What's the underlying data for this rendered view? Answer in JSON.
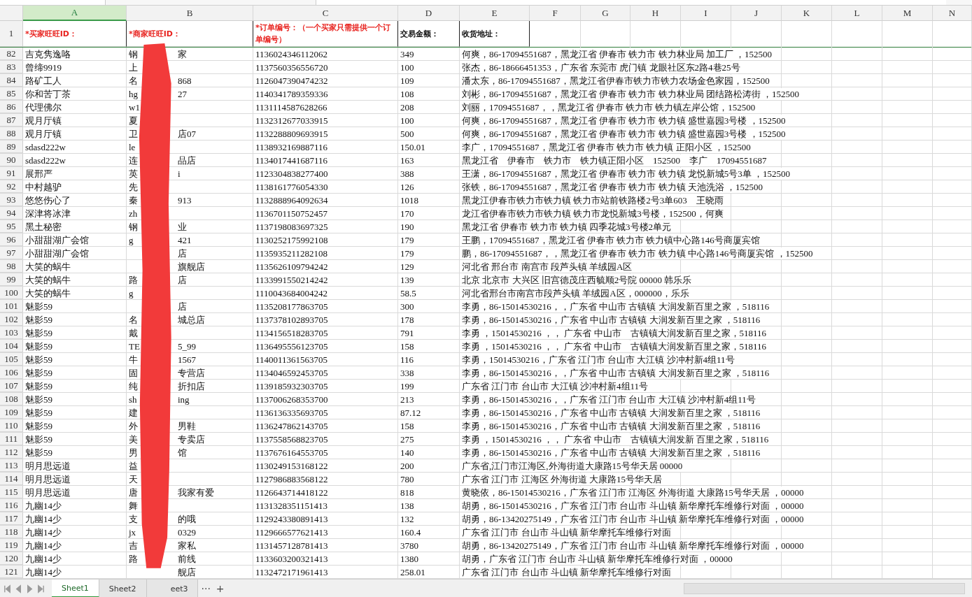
{
  "spreadsheet": {
    "column_headers": [
      {
        "label": "A",
        "selected": true
      },
      {
        "label": "B",
        "selected": false
      },
      {
        "label": "C",
        "selected": false
      },
      {
        "label": "D",
        "selected": false
      },
      {
        "label": "E",
        "selected": false
      },
      {
        "label": "F",
        "selected": false
      },
      {
        "label": "G",
        "selected": false
      },
      {
        "label": "H",
        "selected": false
      },
      {
        "label": "I",
        "selected": false
      },
      {
        "label": "J",
        "selected": false
      },
      {
        "label": "K",
        "selected": false
      },
      {
        "label": "L",
        "selected": false
      },
      {
        "label": "M",
        "selected": false
      },
      {
        "label": "N",
        "selected": false
      }
    ],
    "header_row": {
      "row_number": "1",
      "cells": [
        {
          "text": "*买家旺旺ID：",
          "required": true
        },
        {
          "text": "*商家旺旺ID：",
          "required": true
        },
        {
          "text": "*订单编号：（一个买家只需提供一个订单编号）",
          "required": true
        },
        {
          "text": "交易金额：",
          "required": false
        },
        {
          "text": "收货地址：",
          "required": false
        }
      ]
    },
    "rows": [
      {
        "row_number": "82",
        "buyer_id": "吉克隽逸咯",
        "shop_start": "钢",
        "shop_end": "家",
        "order_no": "1136024346112062",
        "amount": "349",
        "address": "何爽，86-17094551687，黑龙江省 伊春市 铁力市 铁力林业局 加工厂 ，152500"
      },
      {
        "row_number": "83",
        "buyer_id": "曾缔9919",
        "shop_start": "上",
        "order_no": "1137560356556720",
        "amount": "100",
        "address": "张杰，86-18666451353，广东省 东莞市 虎门镇 龙眼社区东2路4巷25号"
      },
      {
        "row_number": "84",
        "buyer_id": "路矿工人",
        "shop_start": "名",
        "shop_end": "868",
        "order_no": "1126047390474232",
        "amount": "109",
        "address": "潘太东，86-17094551687，黑龙江省伊春市铁力市铁力农场金色家园，152500"
      },
      {
        "row_number": "85",
        "buyer_id": "你和苦丁茶",
        "shop_start": "hg",
        "shop_end": "27",
        "order_no": "1140341789359336",
        "amount": "108",
        "address": "刘彬，86-17094551687，黑龙江省 伊春市 铁力市 铁力林业局 团结路松涛街 ，152500"
      },
      {
        "row_number": "86",
        "buyer_id": "代理佛尔",
        "shop_start": "w1",
        "order_no": "1131114587628266",
        "amount": "208",
        "address": "刘丽，17094551687，，黑龙江省 伊春市 铁力市 铁力镇左岸公馆，152500"
      },
      {
        "row_number": "87",
        "buyer_id": "观月厅镇",
        "shop_start": "夏",
        "order_no": "1132312677033915",
        "amount": "100",
        "address": "何爽，86-17094551687，黑龙江省 伊春市 铁力市 铁力镇 盛世嘉园3号楼 ，152500"
      },
      {
        "row_number": "88",
        "buyer_id": "观月厅镇",
        "shop_start": "卫",
        "shop_end": "店07",
        "order_no": "1132288809693915",
        "amount": "500",
        "address": "何爽，86-17094551687，黑龙江省 伊春市 铁力市 铁力镇 盛世嘉园3号楼 ，152500"
      },
      {
        "row_number": "89",
        "buyer_id": "sdasd222w",
        "shop_start": "le",
        "order_no": "1138932169887116",
        "amount": "150.01",
        "address": "李广，17094551687，黑龙江省 伊春市 铁力市 铁力镇 正阳小区 ，152500"
      },
      {
        "row_number": "90",
        "buyer_id": "sdasd222w",
        "shop_start": "连",
        "shop_end": "品店",
        "order_no": "1134017441687116",
        "amount": "163",
        "address": "黑龙江省　伊春市　铁力市　铁力镇正阳小区　152500　李广　17094551687"
      },
      {
        "row_number": "91",
        "buyer_id": "展邢严",
        "shop_start": "英",
        "shop_end": "i",
        "order_no": "1123304838277400",
        "amount": "388",
        "address": "王潇，86-17094551687，黑龙江省 伊春市 铁力市 铁力镇 龙悦新城5号3单 ，152500"
      },
      {
        "row_number": "92",
        "buyer_id": "中村越驴",
        "shop_start": "先",
        "order_no": "1138161776054330",
        "amount": "126",
        "address": "张铁，86-17094551687，黑龙江省 伊春市 铁力市 铁力镇 天池洗浴 ，152500"
      },
      {
        "row_number": "93",
        "buyer_id": "悠悠伤心了",
        "shop_start": "秦",
        "shop_end": "913",
        "order_no": "1132888964092634",
        "amount": "1018",
        "address": "黑龙江伊春市铁力市铁力镇 铁力市站前铁路楼2号3单603　王晓雨"
      },
      {
        "row_number": "94",
        "buyer_id": "深津将冰津",
        "shop_start": "zh",
        "order_no": "1136701150752457",
        "amount": "170",
        "address": "龙江省伊春市铁力市铁力镇 铁力市龙悦新城3号楼，152500，何爽"
      },
      {
        "row_number": "95",
        "buyer_id": "黑土秘密",
        "shop_start": "钢",
        "shop_end": "业",
        "order_no": "1137198083697325",
        "amount": "190",
        "address": "黑龙江省 伊春市 铁力市 铁力镇 四季花城3号楼2单元"
      },
      {
        "row_number": "96",
        "buyer_id": "小甜甜湖广会馆",
        "shop_start": "g",
        "shop_end": "421",
        "order_no": "1130252175992108",
        "amount": "179",
        "address": "王鹏，17094551687，黑龙江省 伊春市 铁力市 铁力镇中心路146号商厦宾馆"
      },
      {
        "row_number": "97",
        "buyer_id": "小甜甜湖广会馆",
        "shop_end": "店",
        "order_no": "1135935211282108",
        "amount": "179",
        "address": "鹏，86-17094551687，，黑龙江省 伊春市 铁力市 铁力镇 中心路146号商厦宾馆 ，152500"
      },
      {
        "row_number": "98",
        "buyer_id": "大笑的蜗牛",
        "shop_end": "旗舰店",
        "order_no": "1135626109794242",
        "amount": "129",
        "address": "河北省 邢台市 南宫市 段芦头镇 羊绒园A区"
      },
      {
        "row_number": "99",
        "buyer_id": "大笑的蜗牛",
        "shop_start": "路",
        "shop_end": "店",
        "order_no": "1133991550214242",
        "amount": "139",
        "address": "北京 北京市 大兴区 旧宫德茂庄西毓顺2号院 00000 韩乐乐"
      },
      {
        "row_number": "100",
        "buyer_id": "大笑的蜗牛",
        "shop_start": "g",
        "order_no": "1110043684004242",
        "amount": "58.5",
        "address": "河北省邢台市南宫市段芦头镇 羊绒园A区，000000，乐乐"
      },
      {
        "row_number": "101",
        "buyer_id": "魅影59",
        "shop_end": "店",
        "order_no": "1135208177863705",
        "amount": "300",
        "address": "李勇，86-15014530216，，广东省 中山市 古镇镇 大润发新百里之家 ，518116"
      },
      {
        "row_number": "102",
        "buyer_id": "魅影59",
        "shop_start": "名",
        "shop_end": "城总店",
        "order_no": "1137378102893705",
        "amount": "178",
        "address": "李勇，86-15014530216，广东省 中山市 古镇镇 大润发新百里之家 ，518116"
      },
      {
        "row_number": "103",
        "buyer_id": "魅影59",
        "shop_start": "戴",
        "order_no": "1134156518283705",
        "amount": "791",
        "address": "李勇 ，15014530216 ，， 广东省 中山市　古镇镇大润发新百里之家，518116"
      },
      {
        "row_number": "104",
        "buyer_id": "魅影59",
        "shop_start": "TE",
        "shop_end": "5_99",
        "order_no": "1136495556123705",
        "amount": "158",
        "address": "李勇 ，15014530216 ，， 广东省 中山市　古镇镇大润发新百里之家，518116"
      },
      {
        "row_number": "105",
        "buyer_id": "魅影59",
        "shop_start": "牛",
        "shop_end": "1567",
        "order_no": "1140011361563705",
        "amount": "116",
        "address": "李勇，15014530216，广东省 江门市 台山市 大江镇 沙冲村新4组11号"
      },
      {
        "row_number": "106",
        "buyer_id": "魅影59",
        "shop_start": "固",
        "shop_end": "专营店",
        "order_no": "1134046592453705",
        "amount": "338",
        "address": "李勇，86-15014530216，，广东省 中山市 古镇镇 大润发新百里之家 ，518116"
      },
      {
        "row_number": "107",
        "buyer_id": "魅影59",
        "shop_start": "纯",
        "shop_end": "折扣店",
        "order_no": "1139185932303705",
        "amount": "199",
        "address": "广东省 江门市 台山市 大江镇 沙冲村新4组11号"
      },
      {
        "row_number": "108",
        "buyer_id": "魅影59",
        "shop_start": "sh",
        "shop_end": "ing",
        "order_no": "1137006268353700",
        "amount": "213",
        "address": "李勇，86-15014530216，，广东省 江门市 台山市 大江镇 沙冲村新4组11号"
      },
      {
        "row_number": "109",
        "buyer_id": "魅影59",
        "shop_start": "建",
        "order_no": "1136136335693705",
        "amount": "87.12",
        "address": "李勇，86-15014530216，广东省 中山市 古镇镇 大润发新百里之家 ，518116"
      },
      {
        "row_number": "110",
        "buyer_id": "魅影59",
        "shop_start": "外",
        "shop_end": "男鞋",
        "order_no": "1136247862143705",
        "amount": "158",
        "address": "李勇，86-15014530216，广东省 中山市 古镇镇 大润发新百里之家 ，518116"
      },
      {
        "row_number": "111",
        "buyer_id": "魅影59",
        "shop_start": "美",
        "shop_end": "专卖店",
        "order_no": "1137558568823705",
        "amount": "275",
        "address": "李勇 ，15014530216 ，， 广东省 中山市　古镇镇大润发新 百里之家，518116"
      },
      {
        "row_number": "112",
        "buyer_id": "魅影59",
        "shop_start": "男",
        "shop_end": "馆",
        "order_no": "1137676164553705",
        "amount": "140",
        "address": "李勇，86-15014530216，广东省 中山市 古镇镇 大润发新百里之家 ，518116"
      },
      {
        "row_number": "113",
        "buyer_id": "明月思远道",
        "shop_start": "益",
        "order_no": "1130249153168122",
        "amount": "200",
        "address": "广东省,江门市江海区,外海街道大康路15号华天居 00000"
      },
      {
        "row_number": "114",
        "buyer_id": "明月思远道",
        "shop_start": "天",
        "order_no": "1127986883568122",
        "amount": "780",
        "address": "广东省 江门市 江海区 外海街道 大康路15号华天居"
      },
      {
        "row_number": "115",
        "buyer_id": "明月思远道",
        "shop_start": "唐",
        "shop_end": "我家有爱",
        "order_no": "1126643714418122",
        "amount": "818",
        "address": "黄晓依，86-15014530216，广东省 江门市 江海区 外海街道 大康路15号华天居 ，00000"
      },
      {
        "row_number": "116",
        "buyer_id": "九幽14少",
        "shop_start": "舞",
        "order_no": "1131328351151413",
        "amount": "138",
        "address": "胡勇，86-15014530216，广东省 江门市 台山市 斗山镇 新华摩托车维修行对面 ，00000"
      },
      {
        "row_number": "117",
        "buyer_id": "九幽14少",
        "shop_start": "支",
        "shop_end": "的哦",
        "order_no": "1129243380891413",
        "amount": "132",
        "address": "胡勇，86-13420275149，广东省 江门市 台山市 斗山镇 新华摩托车维修行对面 ，00000"
      },
      {
        "row_number": "118",
        "buyer_id": "九幽14少",
        "shop_start": "jx",
        "shop_end": "0329",
        "order_no": "1129666577621413",
        "amount": "160.4",
        "address": "广东省 江门市 台山市 斗山镇 新华摩托车维修行对面"
      },
      {
        "row_number": "119",
        "buyer_id": "九幽14少",
        "shop_start": "吉",
        "shop_end": "家私",
        "order_no": "1131457128781413",
        "amount": "3780",
        "address": "胡勇，86-13420275149，广东省 江门市 台山市 斗山镇 新华摩托车维修行对面 ，00000"
      },
      {
        "row_number": "120",
        "buyer_id": "九幽14少",
        "shop_start": "路",
        "shop_end": "前线",
        "order_no": "1133603200321413",
        "amount": "1380",
        "address": "胡勇，广东省 江门市 台山市 斗山镇 新华摩托车维修行对面 ，00000"
      },
      {
        "row_number": "121",
        "buyer_id": "九幽14少",
        "shop_end": "舰店",
        "order_no": "1132472171961413",
        "amount": "258.01",
        "address": "广东省 江门市 台山市 斗山镇 新华摩托车维修行对面"
      }
    ],
    "sheet_tabs": [
      {
        "label": "Sheet1",
        "selected": true
      },
      {
        "label": "Sheet2",
        "selected": false
      },
      {
        "label": "eet3",
        "selected": false
      }
    ],
    "more_tabs": "···",
    "add_sheet": "+"
  }
}
